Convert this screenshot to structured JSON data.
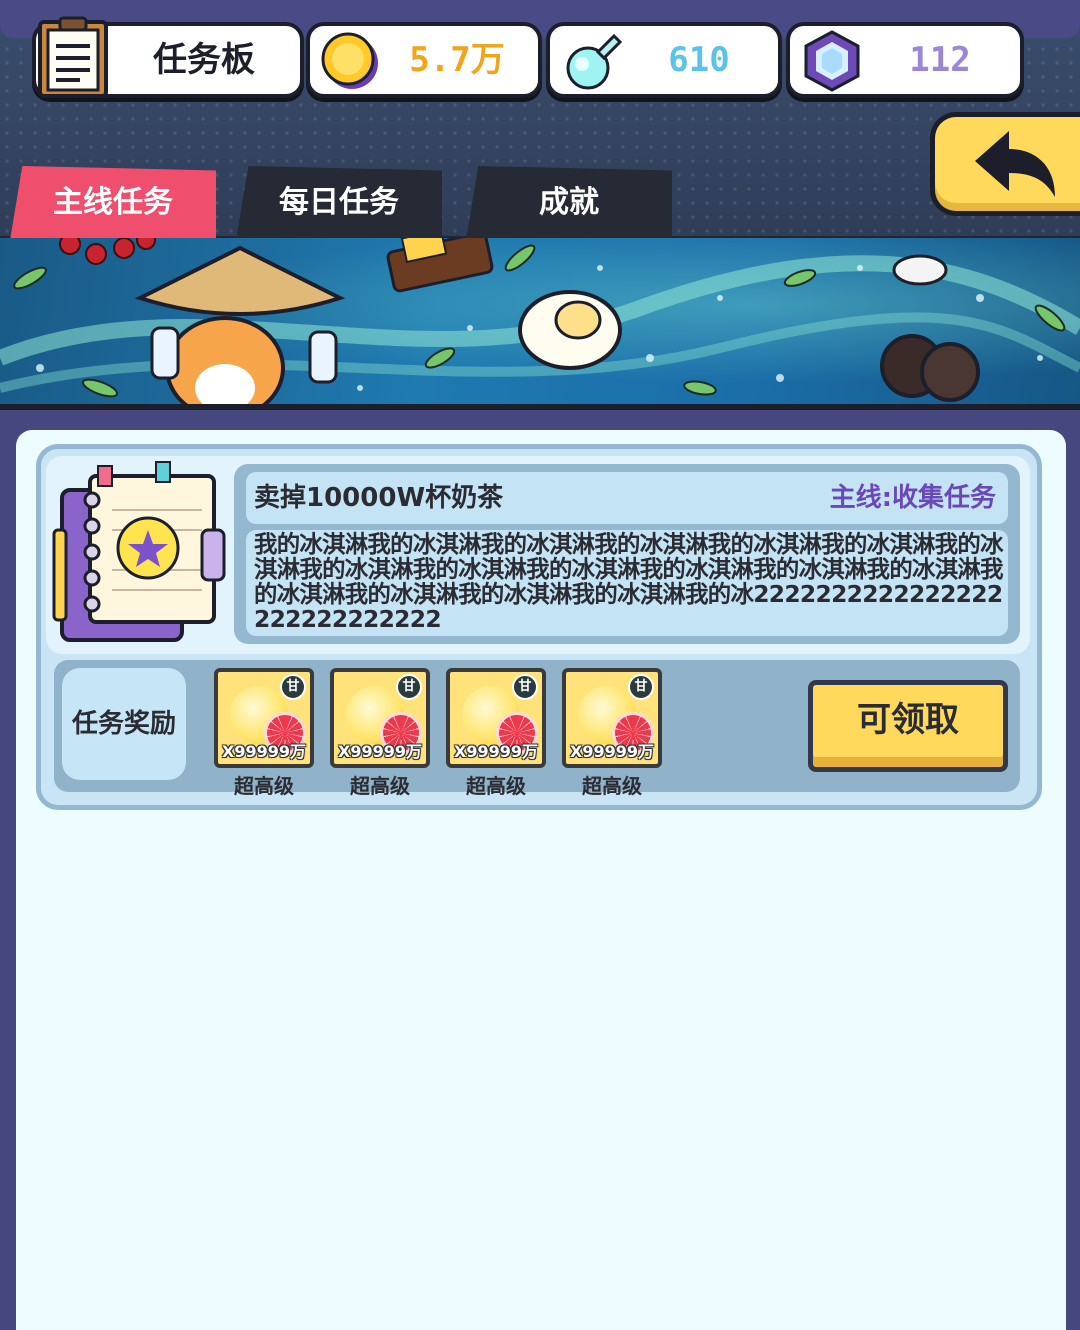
{
  "header": {
    "title": "任务板",
    "coins": "5.7万",
    "potions": "610",
    "gems": "112"
  },
  "tabs": [
    {
      "label": "主线任务",
      "active": true
    },
    {
      "label": "每日任务",
      "active": false
    },
    {
      "label": "成就",
      "active": false
    }
  ],
  "task": {
    "name": "卖掉10000W杯奶茶",
    "category": "主线:收集任务",
    "description": "我的冰淇淋我的冰淇淋我的冰淇淋我的冰淇淋我的冰淇淋我的冰淇淋我的冰淇淋我的冰淇淋我的冰淇淋我的冰淇淋我的冰淇淋我的冰淇淋我的冰淇淋我的冰淇淋我的冰淇淋我的冰淇淋我的冰淇淋我的冰2222222222222222222222222222"
  },
  "rewards": {
    "label": "任务奖励",
    "items": [
      {
        "amount": "X99999万",
        "tier": "超高级",
        "badge": "甘"
      },
      {
        "amount": "X99999万",
        "tier": "超高级",
        "badge": "甘"
      },
      {
        "amount": "X99999万",
        "tier": "超高级",
        "badge": "甘"
      },
      {
        "amount": "X99999万",
        "tier": "超高级",
        "badge": "甘"
      }
    ]
  },
  "claim_button": "可领取",
  "colors": {
    "accent_tab": "#ef4f6d",
    "button_yellow": "#ffd95b",
    "category_purple": "#6a48b8",
    "coin_text": "#f0a61c",
    "potion_text": "#5cc3e8",
    "gem_text": "#9b86d8"
  }
}
